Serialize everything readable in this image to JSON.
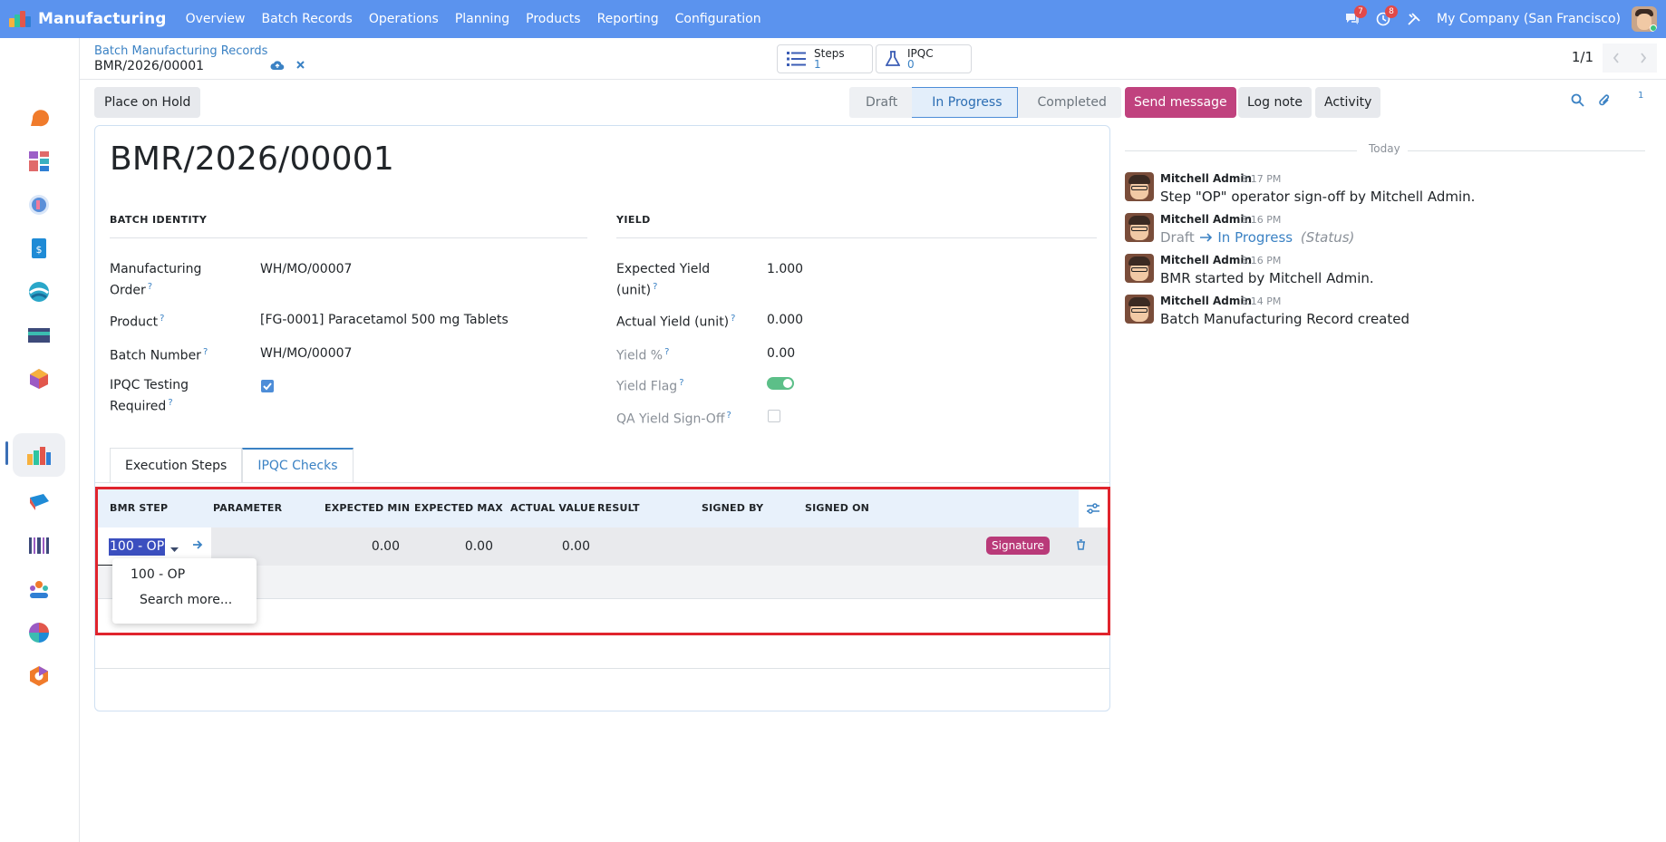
{
  "navbar": {
    "app_name": "Manufacturing",
    "menu": [
      "Overview",
      "Batch Records",
      "Operations",
      "Planning",
      "Products",
      "Reporting",
      "Configuration"
    ],
    "messages_badge": "7",
    "activity_badge": "8",
    "company": "My Company (San Francisco)"
  },
  "breadcrumb": {
    "parent": "Batch Manufacturing Records",
    "current": "BMR/2026/00001"
  },
  "smart_buttons": {
    "steps_label": "Steps",
    "steps_value": "1",
    "ipqc_label": "IPQC",
    "ipqc_value": "0"
  },
  "pager": {
    "text": "1/1"
  },
  "actions": {
    "hold_label": "Place on Hold"
  },
  "statusbar": {
    "stages": [
      "Draft",
      "In Progress",
      "Completed"
    ],
    "active": "In Progress"
  },
  "record": {
    "title": "BMR/2026/00001",
    "batch_identity_title": "BATCH IDENTITY",
    "yield_title": "YIELD",
    "fields_left": [
      {
        "label_line1": "Manufacturing",
        "label_line2": "Order",
        "value": "WH/MO/00007"
      },
      {
        "label_line1": "Product",
        "label_line2": "",
        "value": "[FG-0001] Paracetamol 500 mg Tablets"
      },
      {
        "label_line1": "Batch Number",
        "label_line2": "",
        "value": "WH/MO/00007"
      },
      {
        "label_line1": "IPQC Testing",
        "label_line2": "Required",
        "value": "checked"
      }
    ],
    "fields_right": [
      {
        "label_line1": "Expected Yield",
        "label_line2": "(unit)",
        "value": "1.000"
      },
      {
        "label_line1": "Actual Yield (unit)",
        "label_line2": "",
        "value": "0.000"
      },
      {
        "label_line1": "Yield %",
        "label_line2": "",
        "value": "0.00"
      },
      {
        "label_line1": "Yield Flag",
        "label_line2": "",
        "value": "on"
      },
      {
        "label_line1": "QA Yield Sign-Off",
        "label_line2": "",
        "value": "unchecked"
      }
    ],
    "help_mark": "?"
  },
  "tabs": [
    "Execution Steps",
    "IPQC Checks"
  ],
  "active_tab": "IPQC Checks",
  "ipqc_table": {
    "columns": [
      "BMR STEP",
      "PARAMETER",
      "EXPECTED MIN",
      "EXPECTED MAX",
      "ACTUAL VALUE",
      "RESULT",
      "SIGNED BY",
      "SIGNED ON"
    ],
    "row": {
      "bmr_step": "100 - OP",
      "parameter": "",
      "expected_min": "0.00",
      "expected_max": "0.00",
      "actual_value": "0.00",
      "signature_label": "Signature"
    },
    "dropdown": {
      "option": "100 - OP",
      "search_more": "Search more..."
    }
  },
  "chatter": {
    "send_message": "Send message",
    "log_note": "Log note",
    "activity": "Activity",
    "attachments_count": "1",
    "today_label": "Today",
    "messages": [
      {
        "author": "Mitchell Admin",
        "time": "3:17 PM",
        "body": "Step \"OP\" operator sign-off by Mitchell Admin."
      },
      {
        "author": "Mitchell Admin",
        "time": "3:16 PM",
        "from": "Draft",
        "to": "In Progress",
        "field": "(Status)"
      },
      {
        "author": "Mitchell Admin",
        "time": "3:16 PM",
        "body": "BMR started by Mitchell Admin."
      },
      {
        "author": "Mitchell Admin",
        "time": "3:14 PM",
        "body": "Batch Manufacturing Record created"
      }
    ]
  }
}
